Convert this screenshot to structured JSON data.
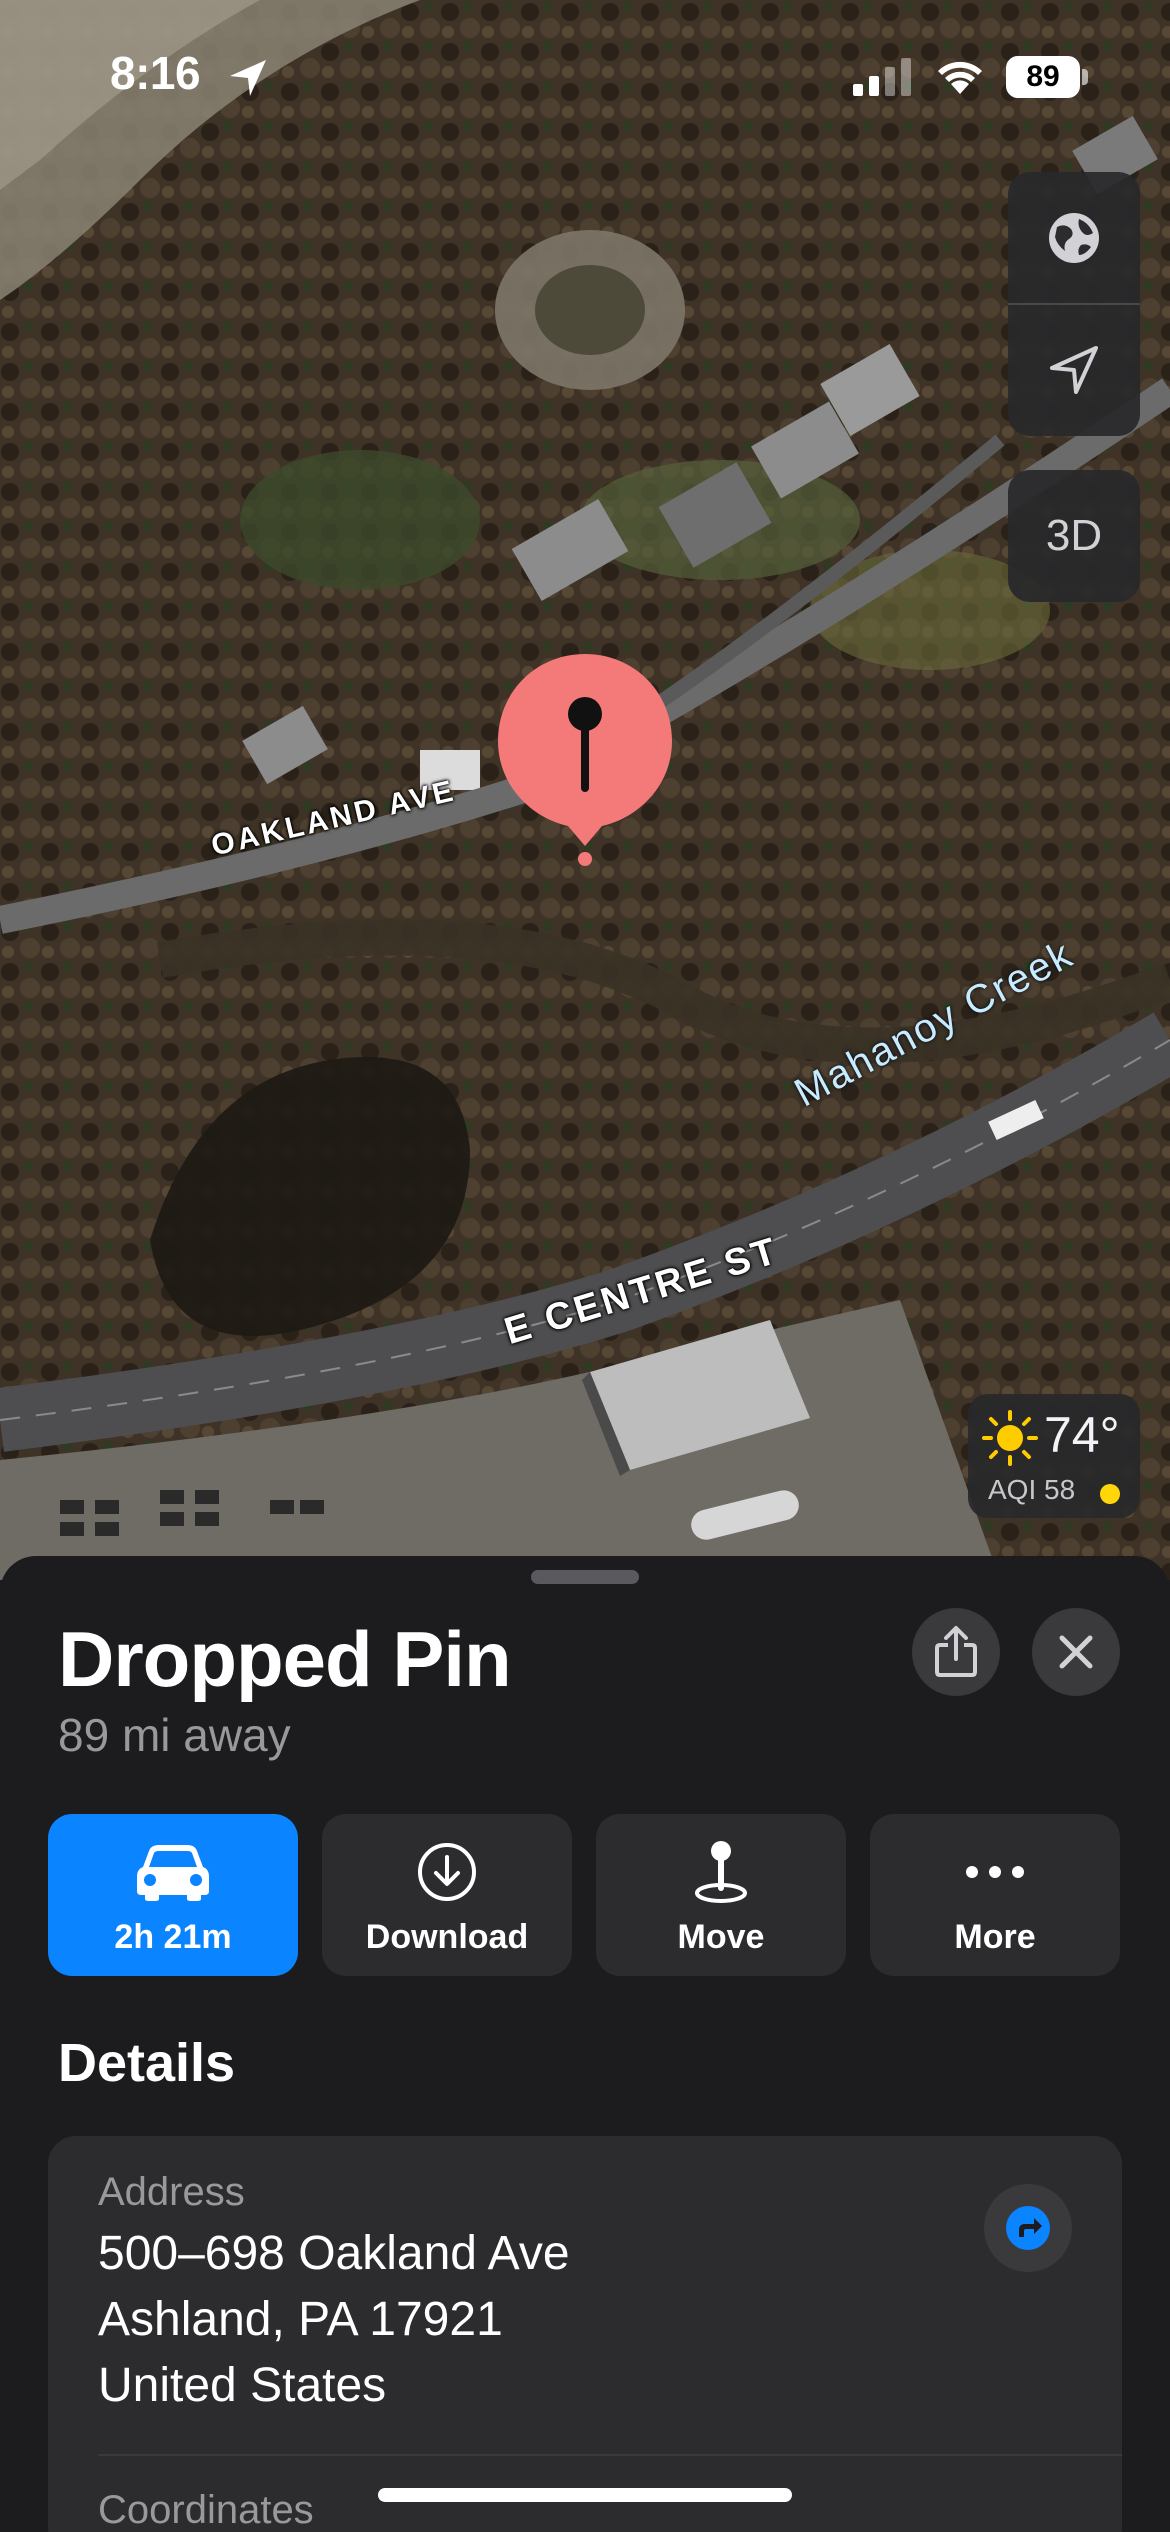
{
  "status_bar": {
    "time": "8:16",
    "battery": "89",
    "location_icon": "location-arrow-icon",
    "signal_icon": "cellular-signal-icon",
    "wifi_icon": "wifi-icon"
  },
  "map": {
    "controls": {
      "globe_icon": "globe-icon",
      "locate_icon": "location-arrow-icon",
      "three_d_label": "3D"
    },
    "labels": {
      "road_1": "OAKLAND AVE",
      "road_2": "E CENTRE ST",
      "creek": "Mahanoy Creek"
    },
    "pin_color": "#f47a7a",
    "weather": {
      "temperature": "74°",
      "aqi": "AQI 58",
      "aqi_color": "#ffd60a",
      "icon": "sun-icon"
    }
  },
  "sheet": {
    "title": "Dropped Pin",
    "subtitle": "89 mi away",
    "actions": [
      {
        "label": "2h 21m",
        "icon": "car-icon",
        "primary": true
      },
      {
        "label": "Download",
        "icon": "download-icon"
      },
      {
        "label": "Move",
        "icon": "move-pin-icon"
      },
      {
        "label": "More",
        "icon": "ellipsis-icon"
      }
    ],
    "details_title": "Details",
    "address_label": "Address",
    "address_lines": [
      "500–698 Oakland Ave",
      "Ashland, PA  17921",
      "United States"
    ],
    "coordinates_label": "Coordinates"
  },
  "colors": {
    "accent": "#0a84ff",
    "sheet_bg": "#1c1c1e",
    "card_bg": "#2c2c2e"
  }
}
